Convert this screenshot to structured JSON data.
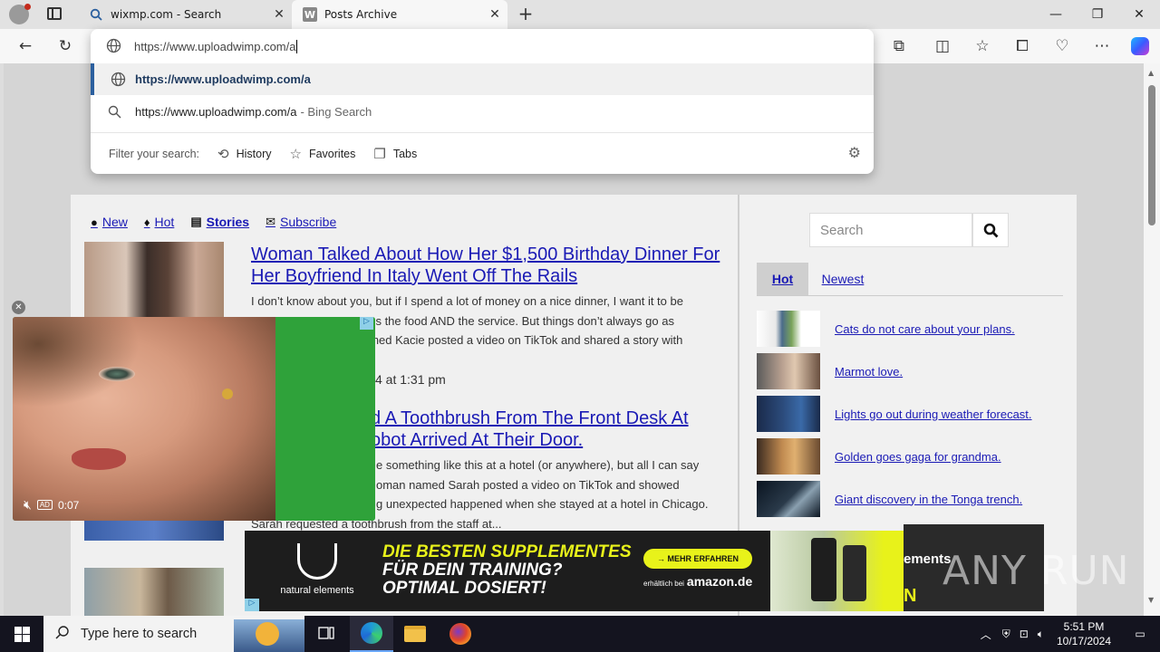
{
  "browser": {
    "tabs": [
      {
        "title": "wixmp.com - Search",
        "icon": "search-icon"
      },
      {
        "title": "Posts Archive",
        "icon": "site-w-icon"
      }
    ],
    "address_input": "https://www.uploadwimp.com/a",
    "suggestions": [
      {
        "text": "https://www.uploadwimp.com/a",
        "icon": "globe-icon"
      },
      {
        "text": "https://www.uploadwimp.com/a",
        "suffix": "- Bing Search",
        "icon": "search-icon"
      }
    ],
    "filter": {
      "label": "Filter your search:",
      "chips": [
        {
          "label": "History",
          "icon": "history-icon"
        },
        {
          "label": "Favorites",
          "icon": "star-icon"
        },
        {
          "label": "Tabs",
          "icon": "tabs-icon"
        }
      ]
    }
  },
  "site": {
    "nav": [
      {
        "label": "New",
        "icon": "clock-icon"
      },
      {
        "label": "Hot",
        "icon": "flame-icon"
      },
      {
        "label": "Stories",
        "icon": "newspaper-icon"
      },
      {
        "label": "Subscribe",
        "icon": "envelope-icon"
      }
    ],
    "stories": [
      {
        "title": "Woman Talked About How Her $1,500 Birthday Dinner For Her Boyfriend In Italy Went Off The Rails",
        "excerpt_lines": [
          "I don’t know about you, but if I spend a lot of money on a nice dinner, I want it to be",
          "ans the food AND the service. But things don’t always go as",
          "amed Kacie posted a video on TikTok and shared a story with",
          "..."
        ],
        "date": "4 at 1:31 pm"
      },
      {
        "title_lines": [
          "d A Toothbrush From The Front Desk At",
          "obot Arrived At Their Door."
        ],
        "excerpt_lines": [
          "e something like this at a hotel (or anywhere), but all I can say",
          "oman named Sarah posted a video on TikTok and showed",
          "g unexpected happened when she stayed at a hotel in Chicago.",
          "Sarah requested a toothbrush from the staff at..."
        ]
      }
    ],
    "sidebar": {
      "search_placeholder": "Search",
      "tabs": [
        "Hot",
        "Newest"
      ],
      "items": [
        "Cats do not care about your plans.",
        "Marmot love.",
        "Lights go out during weather forecast.",
        "Golden goes gaga for grandma.",
        "Giant discovery in the Tonga trench."
      ]
    }
  },
  "video_ad": {
    "time": "0:07",
    "badge": "AD"
  },
  "banner_ad": {
    "brand": "natural elements",
    "headline_highlight": "DIE BESTEN SUPPLEMENTES",
    "headline_rest_1": "FÜR DEIN TRAINING?",
    "headline_rest_2": "OPTIMAL DOSIERT!",
    "cta": "→ MEHR ERFAHREN",
    "amazon_prefix": "erhältlich bei",
    "amazon": "amazon.de",
    "side_text_1": "ements",
    "side_text_2": "N"
  },
  "watermark": "ANY RUN",
  "taskbar": {
    "search_placeholder": "Type here to search",
    "time": "5:51 PM",
    "date": "10/17/2024"
  }
}
